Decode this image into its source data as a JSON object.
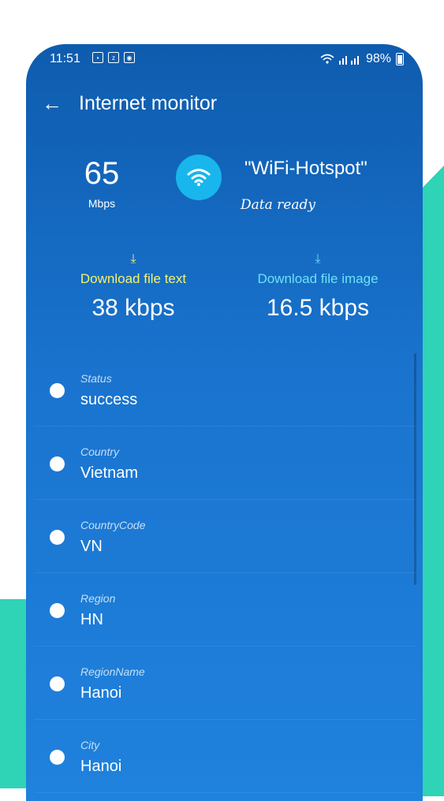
{
  "status_bar": {
    "time": "11:51",
    "battery": "98%"
  },
  "toolbar": {
    "title": "Internet monitor"
  },
  "speed": {
    "value": "65",
    "unit": "Mbps"
  },
  "network": {
    "name": "\"WiFi-Hotspot\"",
    "status": "Data ready"
  },
  "downloads": {
    "text": {
      "label": "Download file text",
      "value": "38 kbps",
      "color": "#f5f26b"
    },
    "image": {
      "label": "Download file image",
      "value": "16.5 kbps",
      "color": "#6be1f5"
    }
  },
  "info": [
    {
      "label": "Status",
      "value": "success"
    },
    {
      "label": "Country",
      "value": "Vietnam"
    },
    {
      "label": "CountryCode",
      "value": "VN"
    },
    {
      "label": "Region",
      "value": "HN"
    },
    {
      "label": "RegionName",
      "value": "Hanoi"
    },
    {
      "label": "City",
      "value": "Hanoi"
    }
  ],
  "colors": {
    "accent": "#18b6ec",
    "teal": "#2fd3b6",
    "background": "#1a74cf"
  },
  "icons": {
    "back": "arrow-left-icon",
    "wifi": "wifi-icon",
    "download": "download-icon"
  }
}
